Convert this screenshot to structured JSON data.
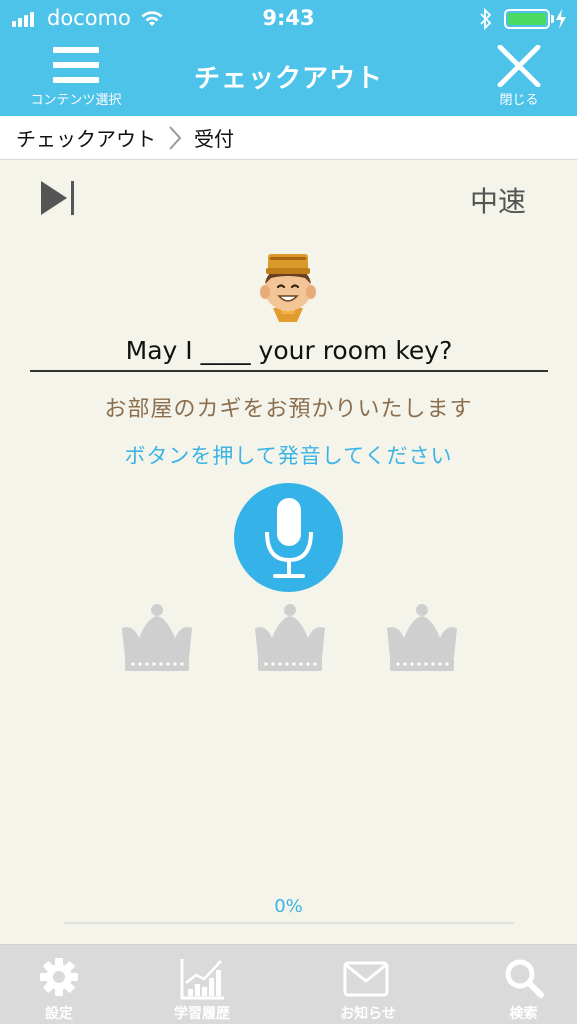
{
  "status_bar": {
    "carrier": "docomo",
    "time": "9:43"
  },
  "nav": {
    "menu_caption": "コンテンツ選択",
    "title": "チェックアウト",
    "close_caption": "閉じる"
  },
  "breadcrumb": {
    "items": [
      "チェックアウト",
      "受付"
    ]
  },
  "controls": {
    "speed": "中速"
  },
  "lesson": {
    "sentence": "May I ____ your room key?",
    "translation": "お部屋のカギをお預かりいたします",
    "instruction": "ボタンを押して発音してください"
  },
  "crowns": {
    "earned": 0,
    "total": 3
  },
  "progress": {
    "label": "0%",
    "value": 0
  },
  "tabs": [
    {
      "label": "設定",
      "icon": "gear-icon"
    },
    {
      "label": "学習履歴",
      "icon": "chart-icon"
    },
    {
      "label": "お知らせ",
      "icon": "mail-icon"
    },
    {
      "label": "検索",
      "icon": "search-icon"
    }
  ],
  "colors": {
    "accent": "#4dc3ea",
    "mic": "#35b3e8",
    "background": "#f4f4ea",
    "translation": "#8b6f4e",
    "crown_inactive": "#cfcfcf"
  }
}
